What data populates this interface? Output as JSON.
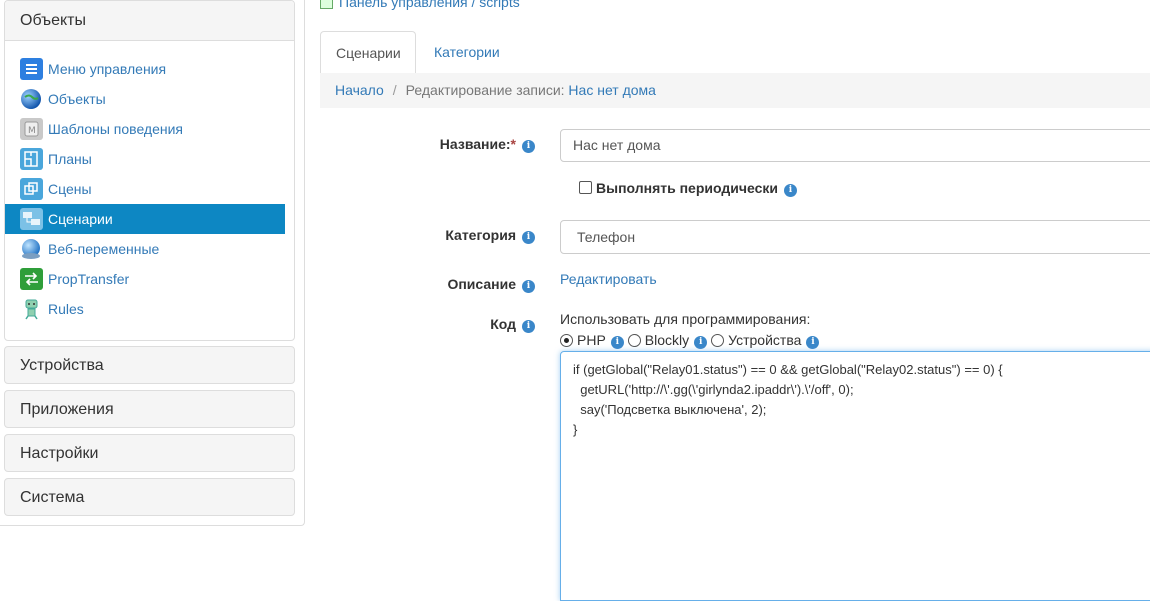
{
  "sidebar": {
    "objects_panel": {
      "title": "Объекты",
      "items": [
        {
          "label": "Меню управления",
          "icon": "menu-icon"
        },
        {
          "label": "Объекты",
          "icon": "globe-icon"
        },
        {
          "label": "Шаблоны поведения",
          "icon": "template-icon"
        },
        {
          "label": "Планы",
          "icon": "floorplan-icon"
        },
        {
          "label": "Сцены",
          "icon": "scenes-icon"
        },
        {
          "label": "Сценарии",
          "icon": "scripts-icon",
          "active": true
        },
        {
          "label": "Веб-переменные",
          "icon": "web-globe-icon"
        },
        {
          "label": "PropTransfer",
          "icon": "transfer-icon"
        },
        {
          "label": "Rules",
          "icon": "robot-icon"
        }
      ]
    },
    "devices_title": "Устройства",
    "apps_title": "Приложения",
    "settings_title": "Настройки",
    "system_title": "Система"
  },
  "top_breadcrumb": "Панель управления / scripts",
  "tabs": [
    "Сценарии",
    "Категории"
  ],
  "breadcrumb": {
    "home": "Начало",
    "separator": "/",
    "edit_label": "Редактирование записи:",
    "record": "Нас нет дома"
  },
  "form": {
    "name_label": "Название:",
    "required_mark": "*",
    "name_value": "Нас нет дома",
    "periodic_label": "Выполнять периодически",
    "periodic_checked": false,
    "category_label": "Категория",
    "category_value": "Телефон",
    "description_label": "Описание",
    "description_link": "Редактировать",
    "code_label": "Код",
    "use_for_programming": "Использовать для программирования:",
    "code_modes": [
      "PHP",
      "Blockly",
      "Устройства"
    ],
    "selected_mode": "PHP",
    "code": "if (getGlobal(\"Relay01.status\") == 0 && getGlobal(\"Relay02.status\") == 0) {\n  getURL('http://\\'.gg(\\'girlynda2.ipaddr\\').\\'/off', 0);\n  say('Подсветка выключена', 2);\n}"
  },
  "colors": {
    "accent": "#337ab7",
    "active_nav_bg": "#0d87c3",
    "info_icon": "#3a87c9",
    "required": "#a94442"
  }
}
